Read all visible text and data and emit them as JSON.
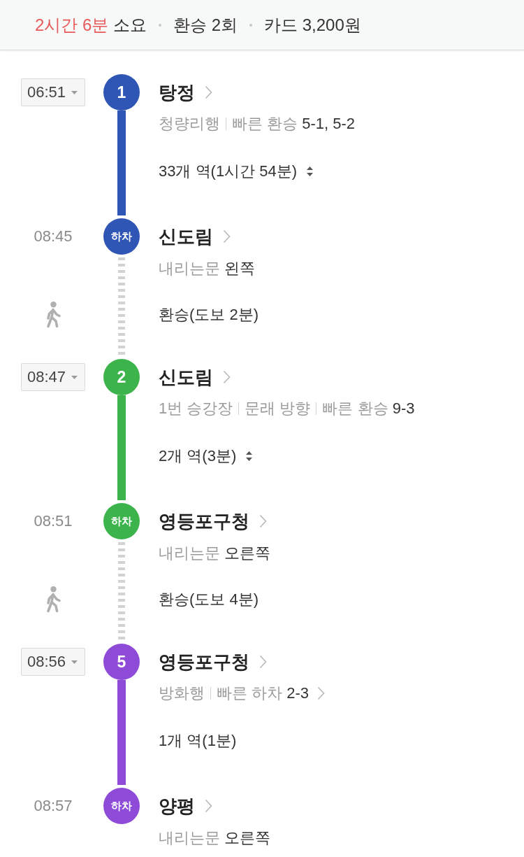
{
  "summary": {
    "duration": "2시간 6분",
    "duration_suffix": "소요",
    "transfers": "환승 2회",
    "fare": "카드 3,200원"
  },
  "steps": [
    {
      "kind": "ride",
      "color": "#2f55b5",
      "line": "1",
      "board": {
        "time": "06:51",
        "station": "탕정",
        "details": [
          {
            "label": "청량리행"
          },
          {
            "label": "빠른 환승",
            "value": "5-1, 5-2"
          }
        ],
        "details_link": false
      },
      "stops": {
        "text": "33개 역(1시간 54분)",
        "expandable": true
      },
      "alight": {
        "time": "08:45",
        "badge": "하차",
        "station": "신도림",
        "details": [
          {
            "label": "내리는문",
            "value": "왼쪽"
          }
        ]
      }
    },
    {
      "kind": "walk",
      "text": "환승(도보 2분)"
    },
    {
      "kind": "ride",
      "color": "#3cb44b",
      "line": "2",
      "board": {
        "time": "08:47",
        "station": "신도림",
        "details": [
          {
            "label": "1번 승강장"
          },
          {
            "label": "문래 방향"
          },
          {
            "label": "빠른 환승",
            "value": "9-3"
          }
        ],
        "details_link": false
      },
      "stops": {
        "text": "2개 역(3분)",
        "expandable": true
      },
      "alight": {
        "time": "08:51",
        "badge": "하차",
        "station": "영등포구청",
        "details": [
          {
            "label": "내리는문",
            "value": "오른쪽"
          }
        ]
      }
    },
    {
      "kind": "walk",
      "text": "환승(도보 4분)"
    },
    {
      "kind": "ride",
      "color": "#8e4bd8",
      "line": "5",
      "board": {
        "time": "08:56",
        "station": "영등포구청",
        "details": [
          {
            "label": "방화행"
          },
          {
            "label": "빠른 하차",
            "value": "2-3"
          }
        ],
        "details_link": true
      },
      "stops": {
        "text": "1개 역(1분)",
        "expandable": false
      },
      "alight": {
        "time": "08:57",
        "badge": "하차",
        "station": "양평",
        "details": [
          {
            "label": "내리는문",
            "value": "오른쪽"
          }
        ]
      }
    }
  ]
}
